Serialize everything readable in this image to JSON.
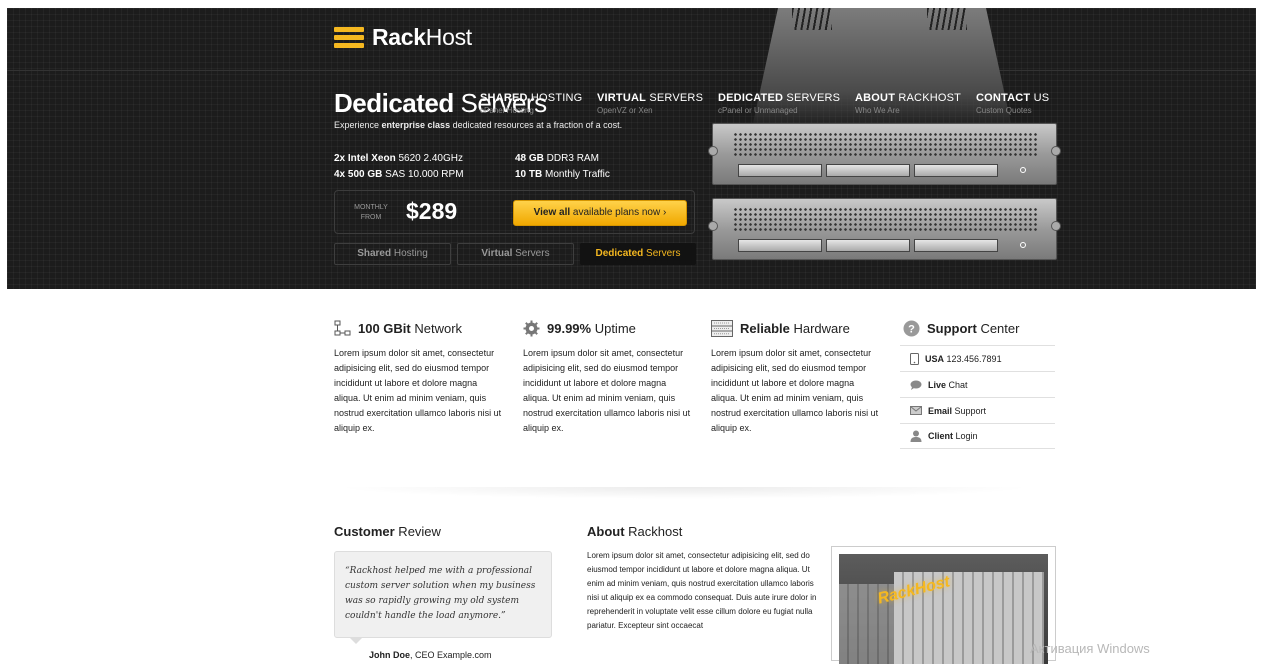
{
  "brand": {
    "name_bold": "Rack",
    "name_light": "Host"
  },
  "nav": [
    {
      "title_bold": "SHARED",
      "title_rest": " HOSTING",
      "sub": "cPanel Hosting"
    },
    {
      "title_bold": "VIRTUAL",
      "title_rest": " SERVERS",
      "sub": "OpenVZ or Xen"
    },
    {
      "title_bold": "DEDICATED",
      "title_rest": " SERVERS",
      "sub": "cPanel or Unmanaged"
    },
    {
      "title_bold": "ABOUT",
      "title_rest": " RACKHOST",
      "sub": "Who We Are"
    },
    {
      "title_bold": "CONTACT",
      "title_rest": " US",
      "sub": "Custom Quotes"
    }
  ],
  "hero": {
    "title_bold": "Dedicated",
    "title_light": " Servers",
    "tag_pre": "Experience ",
    "tag_bold": "enterprise class",
    "tag_post": " dedicated resources at a fraction of a cost.",
    "specs": [
      {
        "bold": "2x Intel Xeon",
        "rest": " 5620 2.40GHz"
      },
      {
        "bold": "4x 500 GB",
        "rest": " SAS 10.000 RPM"
      },
      {
        "bold": "48 GB",
        "rest": " DDR3 RAM"
      },
      {
        "bold": "10 TB",
        "rest": " Monthly Traffic"
      }
    ],
    "price_label_1": "MONTHLY",
    "price_label_2": "FROM",
    "price": "$289",
    "cta_bold": "View all",
    "cta_rest": " available plans now",
    "cta_arrow": "›"
  },
  "tabs": [
    {
      "bold": "Shared",
      "rest": " Hosting",
      "active": false
    },
    {
      "bold": "Virtual",
      "rest": " Servers",
      "active": false
    },
    {
      "bold": "Dedicated",
      "rest": " Servers",
      "active": true
    }
  ],
  "features": [
    {
      "title_bold": "100 GBit",
      "title_rest": " Network",
      "icon": "network-icon",
      "text": "Lorem ipsum dolor sit amet, consectetur adipisicing elit, sed do eiusmod tempor incididunt ut labore et dolore magna aliqua. Ut enim ad minim veniam, quis nostrud exercitation ullamco laboris nisi ut aliquip ex."
    },
    {
      "title_bold": "99.99%",
      "title_rest": " Uptime",
      "icon": "gear-icon",
      "text": "Lorem ipsum dolor sit amet, consectetur adipisicing elit, sed do eiusmod tempor incididunt ut labore et dolore magna aliqua. Ut enim ad minim veniam, quis nostrud exercitation ullamco laboris nisi ut aliquip ex."
    },
    {
      "title_bold": "Reliable",
      "title_rest": " Hardware",
      "icon": "server-rack-icon",
      "text": "Lorem ipsum dolor sit amet, consectetur adipisicing elit, sed do eiusmod tempor incididunt ut labore et dolore magna aliqua. Ut enim ad minim veniam, quis nostrud exercitation ullamco laboris nisi ut aliquip ex."
    }
  ],
  "support": {
    "title_bold": "Support",
    "title_rest": " Center",
    "rows": [
      {
        "bold": "USA",
        "rest": " 123.456.7891",
        "icon": "phone-icon"
      },
      {
        "bold": "Live",
        "rest": " Chat",
        "icon": "chat-icon"
      },
      {
        "bold": "Email",
        "rest": " Support",
        "icon": "envelope-icon"
      },
      {
        "bold": "Client",
        "rest": " Login",
        "icon": "user-icon"
      }
    ]
  },
  "review": {
    "title_bold": "Customer",
    "title_rest": " Review",
    "quote": "“Rackhost helped me with a professional custom server solution when my business was so rapidly growing my old system couldn't handle the load anymore.”",
    "author_bold": "John Doe",
    "author_rest": ", CEO Example.com"
  },
  "about": {
    "title_bold": "About",
    "title_rest": " Rackhost",
    "text": "Lorem ipsum dolor sit amet, consectetur adipisicing elit, sed do eiusmod tempor incididunt ut labore et dolore magna aliqua. Ut enim ad minim veniam, quis nostrud exercitation ullamco laboris nisi ut aliquip ex ea commodo consequat. Duis aute irure dolor in reprehenderit in voluptate velit esse cillum dolore eu fugiat nulla pariatur. Excepteur sint occaecat",
    "photo_logo": "RackHost"
  },
  "watermark": "Активация Windows",
  "colors": {
    "accent": "#f5b820",
    "hero_bg": "#1c1c1c"
  }
}
